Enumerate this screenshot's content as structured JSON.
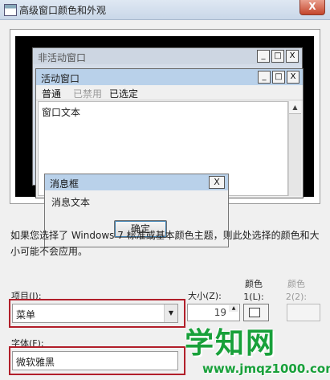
{
  "window": {
    "title": "高级窗口颜色和外观",
    "close_glyph": "X"
  },
  "preview": {
    "inactive_window": {
      "title": "非活动窗口",
      "min_glyph": "_",
      "max_glyph": "□",
      "close_glyph": "X"
    },
    "active_window": {
      "title": "活动窗口",
      "min_glyph": "_",
      "max_glyph": "□",
      "close_glyph": "X",
      "menu": {
        "normal": "普通",
        "disabled": "已禁用",
        "selected": "已选定"
      },
      "window_text": "窗口文本"
    },
    "message_box": {
      "title": "消息框",
      "close_glyph": "X",
      "text": "消息文本",
      "ok_label": "确定"
    }
  },
  "info_text": "如果您选择了 Windows 7 标准或基本颜色主题，则此处选择的颜色和大小可能不会应用。",
  "controls": {
    "item_label": "项目(I):",
    "item_value": "菜单",
    "size_label": "大小(Z):",
    "size_value": "19",
    "color1_label": "颜色 1(L):",
    "color2_label": "颜色 2(2):",
    "font_label": "字体(F):",
    "font_value": "微软雅黑"
  },
  "watermark": {
    "main": "学知网",
    "url": "www.jmqz1000.com"
  },
  "colors": {
    "highlight_border": "#b11f2a",
    "watermark_green": "#18a03a",
    "active_caption": "#b9d1ea"
  }
}
